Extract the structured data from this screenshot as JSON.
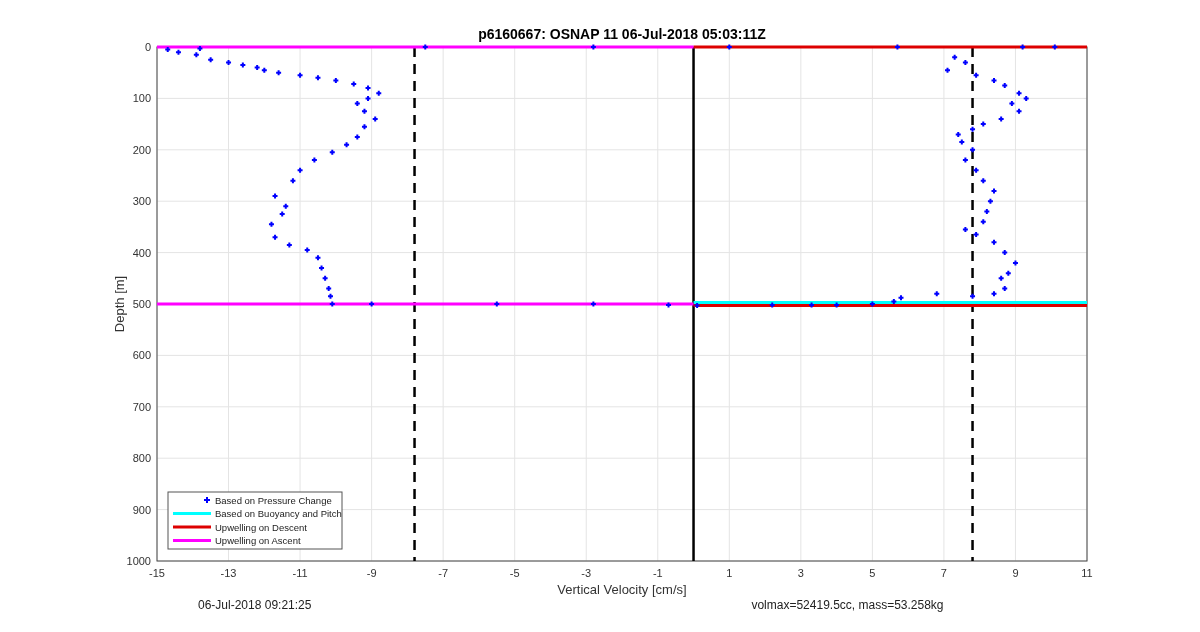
{
  "figure": {
    "chart_data": {
      "type": "scatter",
      "title": "p6160667: OSNAP 11 06-Jul-2018 05:03:11Z",
      "xlabel": "Vertical Velocity [cm/s]",
      "ylabel": "Depth [m]",
      "xlim": [
        -15,
        11
      ],
      "ylim": [
        1000,
        0
      ],
      "xticks": [
        -15,
        -13,
        -11,
        -9,
        -7,
        -5,
        -3,
        -1,
        1,
        3,
        5,
        7,
        9,
        11
      ],
      "yticks": [
        0,
        100,
        200,
        300,
        400,
        500,
        600,
        700,
        800,
        900,
        1000
      ],
      "series": [
        {
          "name": "Based on Pressure Change",
          "color": "#0000ff",
          "x": [
            -14.7,
            -14.4,
            -13.9,
            -13.8,
            -13.5,
            -13,
            -12.6,
            -12.2,
            -12,
            -11.6,
            -11,
            -10.5,
            -10,
            -9.5,
            -9.1,
            -8.8,
            -9.1,
            -9.4,
            -9.2,
            -8.9,
            -9.2,
            -9.4,
            -9.7,
            -10.1,
            -10.6,
            -11,
            -11.2,
            -11.7,
            -11.4,
            -11.5,
            -11.8,
            -11.7,
            -11.3,
            -10.8,
            -10.5,
            -10.4,
            -10.3,
            -10.2,
            -10.15,
            -10.1,
            -9,
            -5.5,
            -2.8,
            -0.7,
            -7.5,
            -2.8,
            1,
            5.7,
            9.2,
            10.1,
            7.3,
            7.6,
            7.1,
            7.9,
            8.4,
            8.7,
            9.1,
            9.3,
            8.9,
            9.1,
            8.6,
            8.1,
            7.8,
            7.4,
            7.5,
            7.8,
            7.6,
            7.9,
            8.1,
            8.4,
            8.3,
            8.2,
            8.1,
            7.6,
            7.9,
            8.4,
            8.7,
            9,
            8.8,
            8.6,
            8.7,
            8.4,
            7.8,
            6.8,
            5.8,
            5.6,
            5,
            4,
            3.3,
            2.2,
            0.1
          ],
          "values": [
            5,
            10,
            15,
            3,
            25,
            30,
            35,
            40,
            45,
            50,
            55,
            60,
            65,
            72,
            80,
            90,
            100,
            110,
            125,
            140,
            155,
            175,
            190,
            205,
            220,
            240,
            260,
            290,
            310,
            325,
            345,
            370,
            385,
            395,
            410,
            430,
            450,
            470,
            485,
            500,
            500,
            500,
            500,
            502,
            0,
            0,
            0,
            0,
            0,
            0,
            20,
            30,
            45,
            55,
            65,
            75,
            90,
            100,
            110,
            125,
            140,
            150,
            160,
            170,
            185,
            200,
            220,
            240,
            260,
            280,
            300,
            320,
            340,
            355,
            365,
            380,
            400,
            420,
            440,
            450,
            470,
            480,
            485,
            480,
            488,
            495,
            500,
            502,
            502,
            502,
            503
          ]
        },
        {
          "name": "Based on Buoyancy and Pitch",
          "color": "#00ffff",
          "type": "line",
          "x": [
            0,
            11
          ],
          "values": [
            497,
            497
          ]
        },
        {
          "name": "Upwelling on Descent",
          "color": "#dd0000",
          "type": "line",
          "x": [
            0,
            11
          ],
          "values": [
            0,
            0
          ]
        },
        {
          "name": "Upwelling on Ascent",
          "color": "#ff00ff",
          "type": "line",
          "x": [
            -15,
            0
          ],
          "values": [
            0,
            0
          ]
        },
        {
          "color": "#dd0000",
          "type": "line",
          "x": [
            0,
            11
          ],
          "values": [
            503,
            503
          ]
        },
        {
          "color": "#ff00ff",
          "type": "line",
          "x": [
            -15,
            0
          ],
          "values": [
            500,
            500
          ]
        }
      ],
      "grid": true,
      "legend": true,
      "ref_lines": [
        {
          "axis": "x",
          "value": -7.8
        },
        {
          "axis": "x",
          "value": 7.8
        }
      ]
    }
  },
  "footer": {
    "timestamp": "06-Jul-2018 09:21:25",
    "summary": "volmax=52419.5cc, mass=53.258kg"
  }
}
